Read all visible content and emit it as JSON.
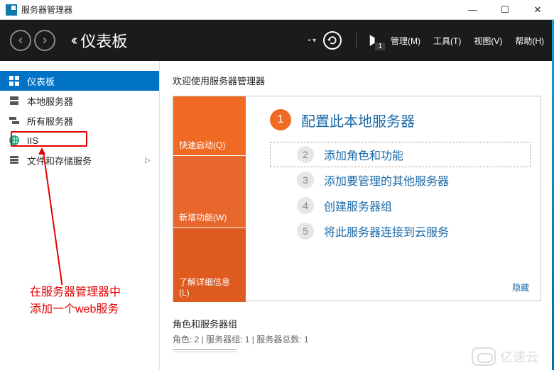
{
  "titlebar": {
    "title": "服务器管理器"
  },
  "header": {
    "page_title": "仪表板",
    "flag_count": "1",
    "menus": {
      "manage": "管理(M)",
      "tools": "工具(T)",
      "view": "视图(V)",
      "help": "帮助(H)"
    }
  },
  "sidebar": {
    "items": [
      {
        "label": "仪表板"
      },
      {
        "label": "本地服务器"
      },
      {
        "label": "所有服务器"
      },
      {
        "label": "IIS"
      },
      {
        "label": "文件和存储服务"
      }
    ]
  },
  "annotation": {
    "line1": "在服务器管理器中",
    "line2": "添加一个web服务"
  },
  "content": {
    "welcome": "欢迎使用服务器管理器",
    "orange": {
      "quickstart": "快速启动(Q)",
      "whatsnew": "新增功能(W)",
      "learnmore": "了解详细信息(L)"
    },
    "steps": {
      "s1": "配置此本地服务器",
      "s2": "添加角色和功能",
      "s3": "添加要管理的其他服务器",
      "s4": "创建服务器组",
      "s5": "将此服务器连接到云服务"
    },
    "hide": "隐藏",
    "roles": {
      "title": "角色和服务器组",
      "sub": "角色: 2 | 服务器组: 1 | 服务器总数: 1"
    }
  },
  "watermark": "亿速云"
}
